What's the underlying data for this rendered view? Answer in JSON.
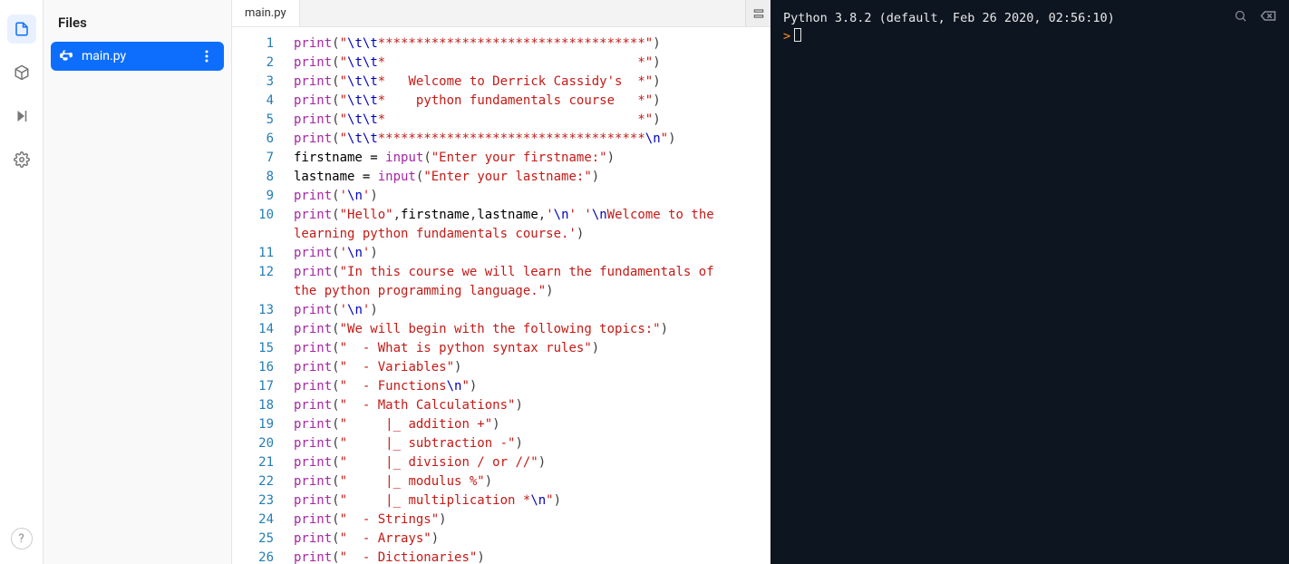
{
  "left_nav": {
    "items": [
      "files",
      "packages",
      "run",
      "settings"
    ],
    "help_label": "?"
  },
  "files_panel": {
    "title": "Files",
    "items": [
      {
        "name": "main.py",
        "icon": "python"
      }
    ]
  },
  "editor": {
    "tabs": [
      {
        "label": "main.py"
      }
    ],
    "code_lines": [
      [
        {
          "t": "k",
          "v": "print"
        },
        {
          "t": "p",
          "v": "("
        },
        {
          "t": "s",
          "v": "\""
        },
        {
          "t": "e",
          "v": "\\t\\t"
        },
        {
          "t": "s",
          "v": "***********************************\""
        },
        {
          "t": "p",
          "v": ")"
        }
      ],
      [
        {
          "t": "k",
          "v": "print"
        },
        {
          "t": "p",
          "v": "("
        },
        {
          "t": "s",
          "v": "\""
        },
        {
          "t": "e",
          "v": "\\t\\t"
        },
        {
          "t": "s",
          "v": "*                                 *\""
        },
        {
          "t": "p",
          "v": ")"
        }
      ],
      [
        {
          "t": "k",
          "v": "print"
        },
        {
          "t": "p",
          "v": "("
        },
        {
          "t": "s",
          "v": "\""
        },
        {
          "t": "e",
          "v": "\\t\\t"
        },
        {
          "t": "s",
          "v": "*   Welcome to Derrick Cassidy's  *\""
        },
        {
          "t": "p",
          "v": ")"
        }
      ],
      [
        {
          "t": "k",
          "v": "print"
        },
        {
          "t": "p",
          "v": "("
        },
        {
          "t": "s",
          "v": "\""
        },
        {
          "t": "e",
          "v": "\\t\\t"
        },
        {
          "t": "s",
          "v": "*    python fundamentals course   *\""
        },
        {
          "t": "p",
          "v": ")"
        }
      ],
      [
        {
          "t": "k",
          "v": "print"
        },
        {
          "t": "p",
          "v": "("
        },
        {
          "t": "s",
          "v": "\""
        },
        {
          "t": "e",
          "v": "\\t\\t"
        },
        {
          "t": "s",
          "v": "*                                 *\""
        },
        {
          "t": "p",
          "v": ")"
        }
      ],
      [
        {
          "t": "k",
          "v": "print"
        },
        {
          "t": "p",
          "v": "("
        },
        {
          "t": "s",
          "v": "\""
        },
        {
          "t": "e",
          "v": "\\t\\t"
        },
        {
          "t": "s",
          "v": "***********************************"
        },
        {
          "t": "e",
          "v": "\\n"
        },
        {
          "t": "s",
          "v": "\""
        },
        {
          "t": "p",
          "v": ")"
        }
      ],
      [
        {
          "t": "n",
          "v": "firstname "
        },
        {
          "t": "op",
          "v": "= "
        },
        {
          "t": "k",
          "v": "input"
        },
        {
          "t": "p",
          "v": "("
        },
        {
          "t": "s",
          "v": "\"Enter your firstname:\""
        },
        {
          "t": "p",
          "v": ")"
        }
      ],
      [
        {
          "t": "n",
          "v": "lastname "
        },
        {
          "t": "op",
          "v": "= "
        },
        {
          "t": "k",
          "v": "input"
        },
        {
          "t": "p",
          "v": "("
        },
        {
          "t": "s",
          "v": "\"Enter your lastname:\""
        },
        {
          "t": "p",
          "v": ")"
        }
      ],
      [
        {
          "t": "k",
          "v": "print"
        },
        {
          "t": "p",
          "v": "("
        },
        {
          "t": "s",
          "v": "'"
        },
        {
          "t": "e",
          "v": "\\n"
        },
        {
          "t": "s",
          "v": "'"
        },
        {
          "t": "p",
          "v": ")"
        }
      ],
      [
        {
          "t": "k",
          "v": "print"
        },
        {
          "t": "p",
          "v": "("
        },
        {
          "t": "s",
          "v": "\"Hello\""
        },
        {
          "t": "p",
          "v": ","
        },
        {
          "t": "n",
          "v": "firstname"
        },
        {
          "t": "p",
          "v": ","
        },
        {
          "t": "n",
          "v": "lastname"
        },
        {
          "t": "p",
          "v": ","
        },
        {
          "t": "s",
          "v": "'"
        },
        {
          "t": "e",
          "v": "\\n"
        },
        {
          "t": "s",
          "v": "' '"
        },
        {
          "t": "e",
          "v": "\\n"
        },
        {
          "t": "s",
          "v": "Welcome to the "
        }
      ],
      [
        {
          "t": "s",
          "v": "learning python fundamentals course.'"
        },
        {
          "t": "p",
          "v": ")"
        }
      ],
      [
        {
          "t": "k",
          "v": "print"
        },
        {
          "t": "p",
          "v": "("
        },
        {
          "t": "s",
          "v": "'"
        },
        {
          "t": "e",
          "v": "\\n"
        },
        {
          "t": "s",
          "v": "'"
        },
        {
          "t": "p",
          "v": ")"
        }
      ],
      [
        {
          "t": "k",
          "v": "print"
        },
        {
          "t": "p",
          "v": "("
        },
        {
          "t": "s",
          "v": "\"In this course we will learn the fundamentals of "
        }
      ],
      [
        {
          "t": "s",
          "v": "the python programming language.\""
        },
        {
          "t": "p",
          "v": ")"
        }
      ],
      [
        {
          "t": "k",
          "v": "print"
        },
        {
          "t": "p",
          "v": "("
        },
        {
          "t": "s",
          "v": "'"
        },
        {
          "t": "e",
          "v": "\\n"
        },
        {
          "t": "s",
          "v": "'"
        },
        {
          "t": "p",
          "v": ")"
        }
      ],
      [
        {
          "t": "k",
          "v": "print"
        },
        {
          "t": "p",
          "v": "("
        },
        {
          "t": "s",
          "v": "\"We will begin with the following topics:\""
        },
        {
          "t": "p",
          "v": ")"
        }
      ],
      [
        {
          "t": "k",
          "v": "print"
        },
        {
          "t": "p",
          "v": "("
        },
        {
          "t": "s",
          "v": "\"  - What is python syntax rules\""
        },
        {
          "t": "p",
          "v": ")"
        }
      ],
      [
        {
          "t": "k",
          "v": "print"
        },
        {
          "t": "p",
          "v": "("
        },
        {
          "t": "s",
          "v": "\"  - Variables\""
        },
        {
          "t": "p",
          "v": ")"
        }
      ],
      [
        {
          "t": "k",
          "v": "print"
        },
        {
          "t": "p",
          "v": "("
        },
        {
          "t": "s",
          "v": "\"  - Functions"
        },
        {
          "t": "e",
          "v": "\\n"
        },
        {
          "t": "s",
          "v": "\""
        },
        {
          "t": "p",
          "v": ")"
        }
      ],
      [
        {
          "t": "k",
          "v": "print"
        },
        {
          "t": "p",
          "v": "("
        },
        {
          "t": "s",
          "v": "\"  - Math Calculations\""
        },
        {
          "t": "p",
          "v": ")"
        }
      ],
      [
        {
          "t": "k",
          "v": "print"
        },
        {
          "t": "p",
          "v": "("
        },
        {
          "t": "s",
          "v": "\"     |_ addition +\""
        },
        {
          "t": "p",
          "v": ")"
        }
      ],
      [
        {
          "t": "k",
          "v": "print"
        },
        {
          "t": "p",
          "v": "("
        },
        {
          "t": "s",
          "v": "\"     |_ subtraction -\""
        },
        {
          "t": "p",
          "v": ")"
        }
      ],
      [
        {
          "t": "k",
          "v": "print"
        },
        {
          "t": "p",
          "v": "("
        },
        {
          "t": "s",
          "v": "\"     |_ division / or //\""
        },
        {
          "t": "p",
          "v": ")"
        }
      ],
      [
        {
          "t": "k",
          "v": "print"
        },
        {
          "t": "p",
          "v": "("
        },
        {
          "t": "s",
          "v": "\"     |_ modulus %\""
        },
        {
          "t": "p",
          "v": ")"
        }
      ],
      [
        {
          "t": "k",
          "v": "print"
        },
        {
          "t": "p",
          "v": "("
        },
        {
          "t": "s",
          "v": "\"     |_ multiplication *"
        },
        {
          "t": "e",
          "v": "\\n"
        },
        {
          "t": "s",
          "v": "\""
        },
        {
          "t": "p",
          "v": ")"
        }
      ],
      [
        {
          "t": "k",
          "v": "print"
        },
        {
          "t": "p",
          "v": "("
        },
        {
          "t": "s",
          "v": "\"  - Strings\""
        },
        {
          "t": "p",
          "v": ")"
        }
      ],
      [
        {
          "t": "k",
          "v": "print"
        },
        {
          "t": "p",
          "v": "("
        },
        {
          "t": "s",
          "v": "\"  - Arrays\""
        },
        {
          "t": "p",
          "v": ")"
        }
      ],
      [
        {
          "t": "k",
          "v": "print"
        },
        {
          "t": "p",
          "v": "("
        },
        {
          "t": "s",
          "v": "\"  - Dictionaries\""
        },
        {
          "t": "p",
          "v": ")"
        }
      ]
    ],
    "line_numbers": [
      1,
      2,
      3,
      4,
      5,
      6,
      7,
      8,
      9,
      10,
      null,
      11,
      12,
      null,
      13,
      14,
      15,
      16,
      17,
      18,
      19,
      20,
      21,
      22,
      23,
      24,
      25,
      26
    ]
  },
  "terminal": {
    "header": "Python 3.8.2 (default, Feb 26 2020, 02:56:10)",
    "prompt": ">"
  }
}
